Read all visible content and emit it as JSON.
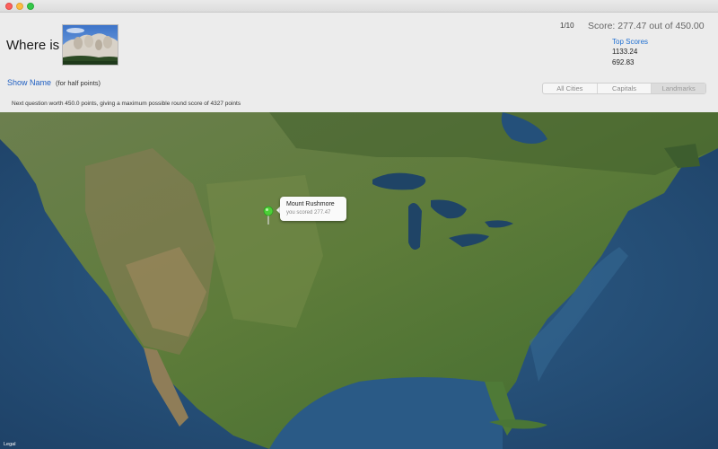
{
  "window": {
    "buttons": [
      "close",
      "minimize",
      "zoom"
    ]
  },
  "header": {
    "prompt": "Where is",
    "image_subject": "Mount Rushmore photo",
    "show_name_label": "Show Name",
    "half_points_note": "(for half points)",
    "footnote": "Next question worth 450.0 points, giving a maximum possible round score of 4327 points"
  },
  "score": {
    "question_counter": "1/10",
    "text": "Score: 277.47 out of 450.00",
    "top_scores_label": "Top Scores",
    "top_scores": [
      "1133.24",
      "692.83"
    ]
  },
  "modes": {
    "items": [
      "All Cities",
      "Capitals",
      "Landmarks"
    ],
    "selected": "Landmarks"
  },
  "map": {
    "pin_color": "#4cd137",
    "callout": {
      "title": "Mount Rushmore",
      "subtitle": "you scored 277.47"
    },
    "legal_label": "Legal"
  }
}
